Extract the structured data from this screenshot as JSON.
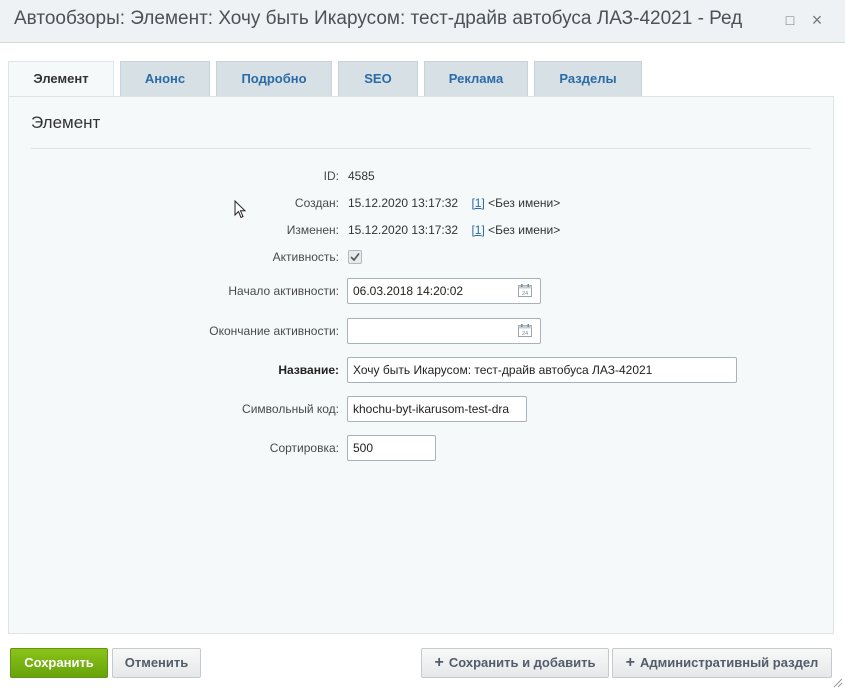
{
  "window": {
    "title": "Автообзоры: Элемент: Хочу быть Икарусом: тест-драйв автобуса ЛАЗ-42021 - Ред",
    "maximize_glyph": "□",
    "close_glyph": "×"
  },
  "tabs": [
    {
      "label": "Элемент",
      "active": true
    },
    {
      "label": "Анонс"
    },
    {
      "label": "Подробно"
    },
    {
      "label": "SEO"
    },
    {
      "label": "Реклама"
    },
    {
      "label": "Разделы"
    }
  ],
  "section": {
    "title": "Элемент"
  },
  "fields": {
    "id": {
      "label": "ID:",
      "value": "4585"
    },
    "created": {
      "label": "Создан:",
      "date": "15.12.2020 13:17:32",
      "user_link": "[1]",
      "user_name": "<Без имени>"
    },
    "modified": {
      "label": "Изменен:",
      "date": "15.12.2020 13:17:32",
      "user_link": "[1]",
      "user_name": "<Без имени>"
    },
    "active": {
      "label": "Активность:",
      "checked": true
    },
    "active_from": {
      "label": "Начало активности:",
      "value": "06.03.2018 14:20:02"
    },
    "active_to": {
      "label": "Окончание активности:",
      "value": ""
    },
    "name": {
      "label": "Название:",
      "value": "Хочу быть Икарусом: тест-драйв автобуса ЛАЗ-42021"
    },
    "code": {
      "label": "Символьный код:",
      "value": "khochu-byt-ikarusom-test-dra"
    },
    "sort": {
      "label": "Сортировка:",
      "value": "500"
    }
  },
  "footer": {
    "save": "Сохранить",
    "cancel": "Отменить",
    "save_add": "Сохранить и добавить",
    "admin_section": "Административный раздел",
    "plus_glyph": "+"
  },
  "colors": {
    "primary_button": "#7ab317",
    "tab_link": "#2a6ba8",
    "panel_bg": "#f5f9f9"
  },
  "icons": [
    "calendar-icon",
    "checkbox-check-icon",
    "plus-icon",
    "resize-grip-icon",
    "mouse-cursor-icon"
  ]
}
